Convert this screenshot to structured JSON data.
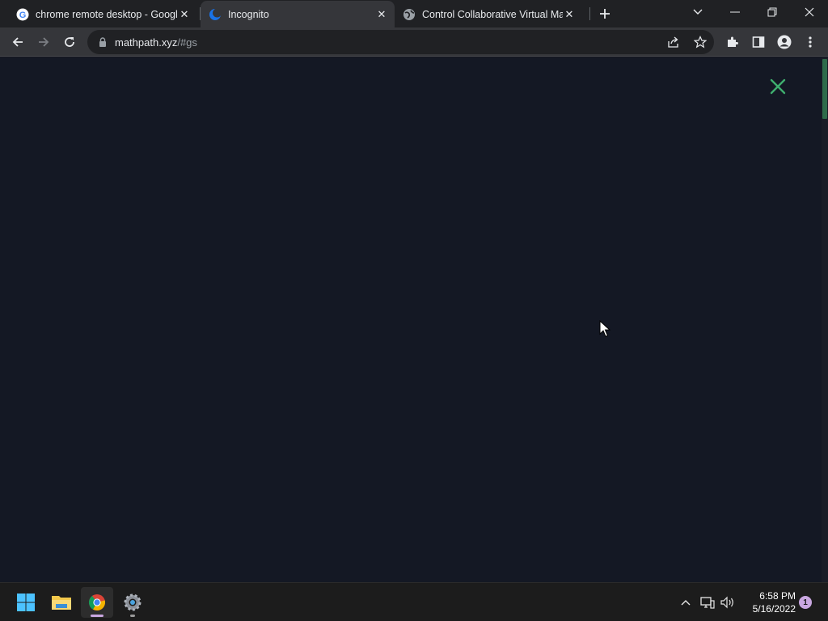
{
  "browser": {
    "tabs": [
      {
        "title": "chrome remote desktop - Google",
        "favicon": "google-icon",
        "active": false
      },
      {
        "title": "Incognito",
        "favicon": "incognito-moon-icon",
        "active": true
      },
      {
        "title": "Control Collaborative Virtual Mac",
        "favicon": "globe-icon",
        "active": false
      }
    ],
    "new_tab": "+",
    "address": {
      "host": "mathpath.xyz",
      "path": "/#gs"
    }
  },
  "page": {
    "close_color": "#3fae6e",
    "background": "#141824"
  },
  "taskbar": {
    "apps": [
      "windows-start-icon",
      "file-explorer-icon",
      "chrome-icon",
      "settings-icon"
    ],
    "clock": {
      "time": "6:58 PM",
      "date": "5/16/2022"
    },
    "notification_count": "1"
  }
}
